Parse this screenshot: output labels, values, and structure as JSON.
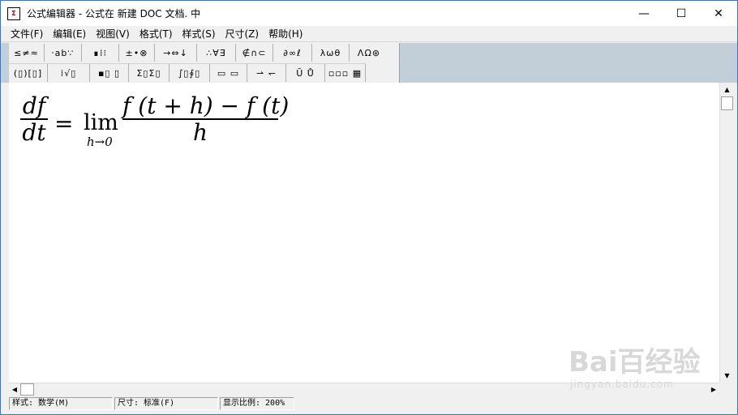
{
  "window": {
    "title": "公式编辑器 - 公式在 新建 DOC 文档. 中",
    "icon": "app-icon",
    "controls": {
      "minimize": "—",
      "maximize": "☐",
      "close": "✕"
    }
  },
  "menu": [
    {
      "label": "文件(F)"
    },
    {
      "label": "编辑(E)"
    },
    {
      "label": "视图(V)"
    },
    {
      "label": "格式(T)"
    },
    {
      "label": "样式(S)"
    },
    {
      "label": "尺寸(Z)"
    },
    {
      "label": "帮助(H)"
    }
  ],
  "toolbar": {
    "row1": [
      {
        "name": "relations-palette",
        "glyph": "≤≠≈"
      },
      {
        "name": "spaces-palette",
        "glyph": "⸱ab∵"
      },
      {
        "name": "embellishments-palette",
        "glyph": "∎⁞⁝"
      },
      {
        "name": "operators-palette",
        "glyph": "±•⊗"
      },
      {
        "name": "arrows-palette",
        "glyph": "→⇔↓"
      },
      {
        "name": "logic-palette",
        "glyph": "∴∀∃"
      },
      {
        "name": "set-theory-palette",
        "glyph": "∉∩⊂"
      },
      {
        "name": "misc-symbols-palette",
        "glyph": "∂∞ℓ"
      },
      {
        "name": "greek-lower-palette",
        "glyph": "λωθ"
      },
      {
        "name": "greek-upper-palette",
        "glyph": "ΛΩ⊛"
      }
    ],
    "row2": [
      {
        "name": "fences-palette",
        "glyph": "(▯)[▯]"
      },
      {
        "name": "fractions-radicals-palette",
        "glyph": "⁞√▯"
      },
      {
        "name": "subscripts-palette",
        "glyph": "▪▯ ▯"
      },
      {
        "name": "summation-palette",
        "glyph": "Σ▯Σ▯"
      },
      {
        "name": "integrals-palette",
        "glyph": "∫▯∮▯"
      },
      {
        "name": "bars-palette",
        "glyph": "▭ ▭"
      },
      {
        "name": "labeled-arrows-palette",
        "glyph": "⇀ ↽"
      },
      {
        "name": "products-palette",
        "glyph": "Ū Ů"
      },
      {
        "name": "matrices-palette",
        "glyph": "▫▫▫ ▦"
      }
    ]
  },
  "formula": {
    "lhs_num": "df",
    "lhs_den": "dt",
    "equals": "=",
    "operator": "lim",
    "limit": "h→0",
    "rhs_num": "f (t + h) − f (t)",
    "rhs_den": "h"
  },
  "status": {
    "style": "样式: 数学(M)",
    "size": "尺寸: 标准(F)",
    "zoom": "显示比例: 200%"
  },
  "watermark": {
    "main": "Bai百经验",
    "sub": "jingyan.baidu.com"
  }
}
